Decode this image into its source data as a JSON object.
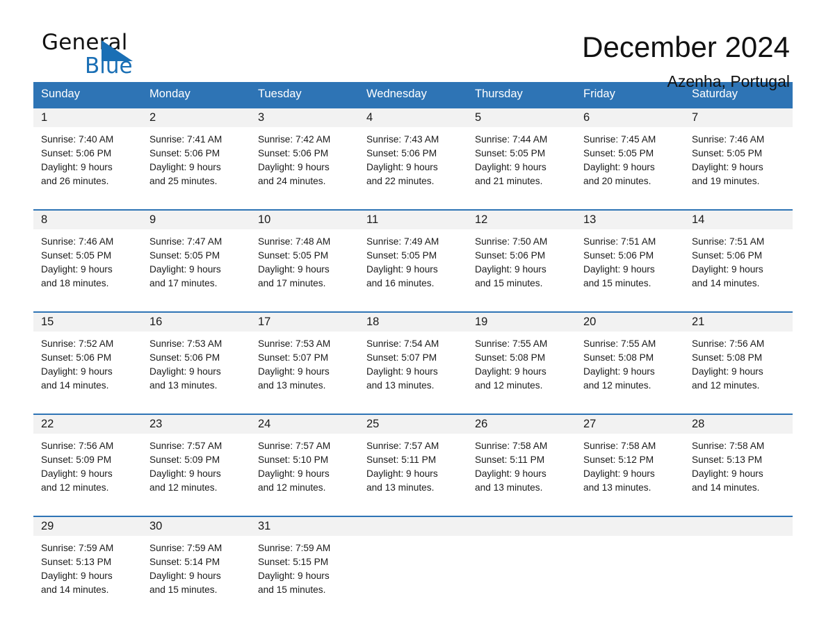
{
  "brand": {
    "name_part1": "General",
    "name_part2": "Blue",
    "triangle_color": "#1a6fb5"
  },
  "header": {
    "title": "December 2024",
    "location": "Azenha, Portugal"
  },
  "theme": {
    "header_blue": "#2e74b5",
    "daynum_gray": "#f2f2f2",
    "text": "#1a1a1a"
  },
  "weekdays": [
    "Sunday",
    "Monday",
    "Tuesday",
    "Wednesday",
    "Thursday",
    "Friday",
    "Saturday"
  ],
  "weeks": [
    [
      {
        "day": "1",
        "sunrise": "Sunrise: 7:40 AM",
        "sunset": "Sunset: 5:06 PM",
        "daylight_line1": "Daylight: 9 hours",
        "daylight_line2": "and 26 minutes."
      },
      {
        "day": "2",
        "sunrise": "Sunrise: 7:41 AM",
        "sunset": "Sunset: 5:06 PM",
        "daylight_line1": "Daylight: 9 hours",
        "daylight_line2": "and 25 minutes."
      },
      {
        "day": "3",
        "sunrise": "Sunrise: 7:42 AM",
        "sunset": "Sunset: 5:06 PM",
        "daylight_line1": "Daylight: 9 hours",
        "daylight_line2": "and 24 minutes."
      },
      {
        "day": "4",
        "sunrise": "Sunrise: 7:43 AM",
        "sunset": "Sunset: 5:06 PM",
        "daylight_line1": "Daylight: 9 hours",
        "daylight_line2": "and 22 minutes."
      },
      {
        "day": "5",
        "sunrise": "Sunrise: 7:44 AM",
        "sunset": "Sunset: 5:05 PM",
        "daylight_line1": "Daylight: 9 hours",
        "daylight_line2": "and 21 minutes."
      },
      {
        "day": "6",
        "sunrise": "Sunrise: 7:45 AM",
        "sunset": "Sunset: 5:05 PM",
        "daylight_line1": "Daylight: 9 hours",
        "daylight_line2": "and 20 minutes."
      },
      {
        "day": "7",
        "sunrise": "Sunrise: 7:46 AM",
        "sunset": "Sunset: 5:05 PM",
        "daylight_line1": "Daylight: 9 hours",
        "daylight_line2": "and 19 minutes."
      }
    ],
    [
      {
        "day": "8",
        "sunrise": "Sunrise: 7:46 AM",
        "sunset": "Sunset: 5:05 PM",
        "daylight_line1": "Daylight: 9 hours",
        "daylight_line2": "and 18 minutes."
      },
      {
        "day": "9",
        "sunrise": "Sunrise: 7:47 AM",
        "sunset": "Sunset: 5:05 PM",
        "daylight_line1": "Daylight: 9 hours",
        "daylight_line2": "and 17 minutes."
      },
      {
        "day": "10",
        "sunrise": "Sunrise: 7:48 AM",
        "sunset": "Sunset: 5:05 PM",
        "daylight_line1": "Daylight: 9 hours",
        "daylight_line2": "and 17 minutes."
      },
      {
        "day": "11",
        "sunrise": "Sunrise: 7:49 AM",
        "sunset": "Sunset: 5:05 PM",
        "daylight_line1": "Daylight: 9 hours",
        "daylight_line2": "and 16 minutes."
      },
      {
        "day": "12",
        "sunrise": "Sunrise: 7:50 AM",
        "sunset": "Sunset: 5:06 PM",
        "daylight_line1": "Daylight: 9 hours",
        "daylight_line2": "and 15 minutes."
      },
      {
        "day": "13",
        "sunrise": "Sunrise: 7:51 AM",
        "sunset": "Sunset: 5:06 PM",
        "daylight_line1": "Daylight: 9 hours",
        "daylight_line2": "and 15 minutes."
      },
      {
        "day": "14",
        "sunrise": "Sunrise: 7:51 AM",
        "sunset": "Sunset: 5:06 PM",
        "daylight_line1": "Daylight: 9 hours",
        "daylight_line2": "and 14 minutes."
      }
    ],
    [
      {
        "day": "15",
        "sunrise": "Sunrise: 7:52 AM",
        "sunset": "Sunset: 5:06 PM",
        "daylight_line1": "Daylight: 9 hours",
        "daylight_line2": "and 14 minutes."
      },
      {
        "day": "16",
        "sunrise": "Sunrise: 7:53 AM",
        "sunset": "Sunset: 5:06 PM",
        "daylight_line1": "Daylight: 9 hours",
        "daylight_line2": "and 13 minutes."
      },
      {
        "day": "17",
        "sunrise": "Sunrise: 7:53 AM",
        "sunset": "Sunset: 5:07 PM",
        "daylight_line1": "Daylight: 9 hours",
        "daylight_line2": "and 13 minutes."
      },
      {
        "day": "18",
        "sunrise": "Sunrise: 7:54 AM",
        "sunset": "Sunset: 5:07 PM",
        "daylight_line1": "Daylight: 9 hours",
        "daylight_line2": "and 13 minutes."
      },
      {
        "day": "19",
        "sunrise": "Sunrise: 7:55 AM",
        "sunset": "Sunset: 5:08 PM",
        "daylight_line1": "Daylight: 9 hours",
        "daylight_line2": "and 12 minutes."
      },
      {
        "day": "20",
        "sunrise": "Sunrise: 7:55 AM",
        "sunset": "Sunset: 5:08 PM",
        "daylight_line1": "Daylight: 9 hours",
        "daylight_line2": "and 12 minutes."
      },
      {
        "day": "21",
        "sunrise": "Sunrise: 7:56 AM",
        "sunset": "Sunset: 5:08 PM",
        "daylight_line1": "Daylight: 9 hours",
        "daylight_line2": "and 12 minutes."
      }
    ],
    [
      {
        "day": "22",
        "sunrise": "Sunrise: 7:56 AM",
        "sunset": "Sunset: 5:09 PM",
        "daylight_line1": "Daylight: 9 hours",
        "daylight_line2": "and 12 minutes."
      },
      {
        "day": "23",
        "sunrise": "Sunrise: 7:57 AM",
        "sunset": "Sunset: 5:09 PM",
        "daylight_line1": "Daylight: 9 hours",
        "daylight_line2": "and 12 minutes."
      },
      {
        "day": "24",
        "sunrise": "Sunrise: 7:57 AM",
        "sunset": "Sunset: 5:10 PM",
        "daylight_line1": "Daylight: 9 hours",
        "daylight_line2": "and 12 minutes."
      },
      {
        "day": "25",
        "sunrise": "Sunrise: 7:57 AM",
        "sunset": "Sunset: 5:11 PM",
        "daylight_line1": "Daylight: 9 hours",
        "daylight_line2": "and 13 minutes."
      },
      {
        "day": "26",
        "sunrise": "Sunrise: 7:58 AM",
        "sunset": "Sunset: 5:11 PM",
        "daylight_line1": "Daylight: 9 hours",
        "daylight_line2": "and 13 minutes."
      },
      {
        "day": "27",
        "sunrise": "Sunrise: 7:58 AM",
        "sunset": "Sunset: 5:12 PM",
        "daylight_line1": "Daylight: 9 hours",
        "daylight_line2": "and 13 minutes."
      },
      {
        "day": "28",
        "sunrise": "Sunrise: 7:58 AM",
        "sunset": "Sunset: 5:13 PM",
        "daylight_line1": "Daylight: 9 hours",
        "daylight_line2": "and 14 minutes."
      }
    ],
    [
      {
        "day": "29",
        "sunrise": "Sunrise: 7:59 AM",
        "sunset": "Sunset: 5:13 PM",
        "daylight_line1": "Daylight: 9 hours",
        "daylight_line2": "and 14 minutes."
      },
      {
        "day": "30",
        "sunrise": "Sunrise: 7:59 AM",
        "sunset": "Sunset: 5:14 PM",
        "daylight_line1": "Daylight: 9 hours",
        "daylight_line2": "and 15 minutes."
      },
      {
        "day": "31",
        "sunrise": "Sunrise: 7:59 AM",
        "sunset": "Sunset: 5:15 PM",
        "daylight_line1": "Daylight: 9 hours",
        "daylight_line2": "and 15 minutes."
      },
      {
        "day": "",
        "sunrise": "",
        "sunset": "",
        "daylight_line1": "",
        "daylight_line2": ""
      },
      {
        "day": "",
        "sunrise": "",
        "sunset": "",
        "daylight_line1": "",
        "daylight_line2": ""
      },
      {
        "day": "",
        "sunrise": "",
        "sunset": "",
        "daylight_line1": "",
        "daylight_line2": ""
      },
      {
        "day": "",
        "sunrise": "",
        "sunset": "",
        "daylight_line1": "",
        "daylight_line2": ""
      }
    ]
  ]
}
